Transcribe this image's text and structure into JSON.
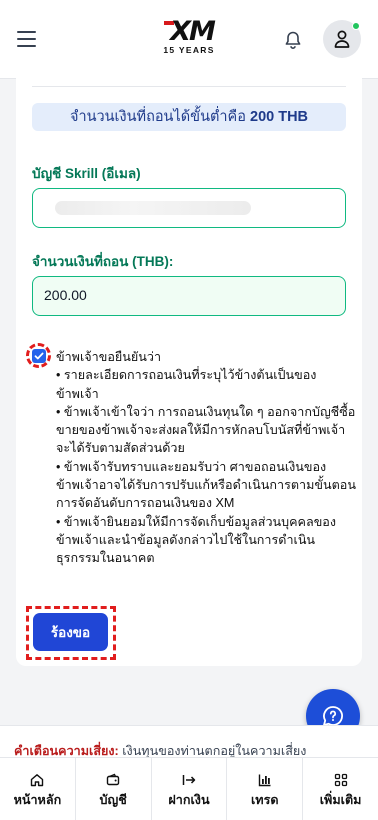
{
  "header": {
    "logo_text": "XM",
    "logo_subtitle": "15 YEARS"
  },
  "form": {
    "min_withdrawal_prefix": "จำนวนเงินที่ถอนได้ขั้นต่ำคือ",
    "min_withdrawal_amount": "200 THB",
    "skrill_label": "บัญชี Skrill (อีเมล)",
    "amount_label": "จำนวนเงินที่ถอน (THB):",
    "amount_value": "200.00",
    "consent_title": "ข้าพเจ้าขอยืนยันว่า",
    "consent_checked": true,
    "consent_bullets": [
      "• รายละเอียดการถอนเงินที่ระบุไว้ข้างต้นเป็นของข้าพเจ้า",
      "• ข้าพเจ้าเข้าใจว่า การถอนเงินทุนใด ๆ ออกจากบัญชีซื้อขายของข้าพเจ้าจะส่งผลให้มีการหักลบโบนัสที่ข้าพเจ้าจะได้รับตามสัดส่วนด้วย",
      "• ข้าพเจ้ารับทราบและยอมรับว่า ศาขอถอนเงินของข้าพเจ้าอาจได้รับการปรับแก้หรือดำเนินการตามขั้นตอนการจัดอันดับการถอนเงินของ XM",
      "• ข้าพเจ้ายินยอมให้มีการจัดเก็บข้อมูลส่วนบุคคลของข้าพเจ้าและนำข้อมูลดังกล่าวไปใช้ในการดำเนินธุรกรรมในอนาคต"
    ],
    "submit_label": "ร้องขอ"
  },
  "risk_warning": {
    "title": "คำเตือนความเสี่ยง:",
    "text": " เงินทุนของท่านตกอยู่ในความเสี่ยง"
  },
  "tabs": [
    {
      "label": "หน้าหลัก",
      "icon": "home-icon"
    },
    {
      "label": "บัญชี",
      "icon": "wallet-icon"
    },
    {
      "label": "ฝากเงิน",
      "icon": "deposit-icon"
    },
    {
      "label": "เทรด",
      "icon": "chart-icon"
    },
    {
      "label": "เพิ่มเติม",
      "icon": "grid-icon"
    }
  ],
  "colors": {
    "accent": "#2046d6",
    "label_green": "#047857",
    "input_border": "#10b981",
    "highlight": "#e11d1d",
    "risk_red": "#b91c1c"
  }
}
